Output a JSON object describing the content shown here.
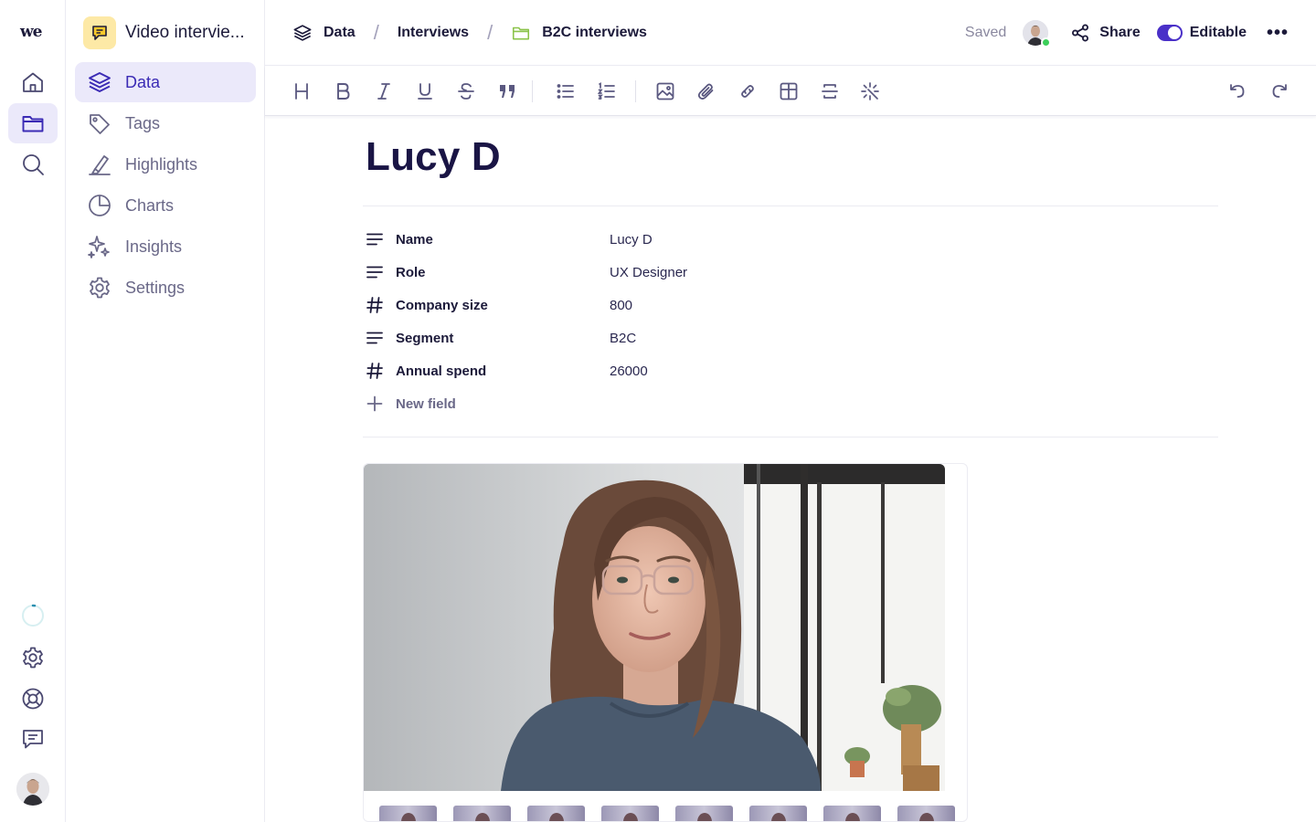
{
  "app": {
    "logo": "we",
    "project_name": "Video intervie..."
  },
  "rail": {
    "items": [
      {
        "icon": "home-icon"
      },
      {
        "icon": "folder-icon",
        "active": true
      },
      {
        "icon": "search-icon"
      }
    ],
    "bottom": [
      {
        "icon": "spinner-icon"
      },
      {
        "icon": "gear-icon"
      },
      {
        "icon": "help-lifebuoy-icon"
      },
      {
        "icon": "chat-icon"
      },
      {
        "icon": "avatar"
      }
    ]
  },
  "sidebar": {
    "items": [
      {
        "label": "Data",
        "icon": "layers-icon",
        "active": true
      },
      {
        "label": "Tags",
        "icon": "tag-icon"
      },
      {
        "label": "Highlights",
        "icon": "highlighter-icon"
      },
      {
        "label": "Charts",
        "icon": "pie-chart-icon"
      },
      {
        "label": "Insights",
        "icon": "sparkles-icon"
      },
      {
        "label": "Settings",
        "icon": "gear-icon"
      }
    ]
  },
  "breadcrumb": {
    "items": [
      {
        "label": "Data",
        "icon": "layers-icon"
      },
      {
        "label": "Interviews"
      },
      {
        "label": "B2C interviews",
        "icon": "folder-icon"
      }
    ],
    "separator": "/"
  },
  "header": {
    "saved": "Saved",
    "share": "Share",
    "editable": "Editable",
    "more": "•••"
  },
  "toolbar": {
    "buttons": [
      "heading",
      "bold",
      "italic",
      "underline",
      "strikethrough",
      "quote",
      "bullet-list",
      "numbered-list",
      "image",
      "attachment",
      "link",
      "table",
      "divider",
      "magic"
    ],
    "undo": "undo",
    "redo": "redo"
  },
  "document": {
    "title": "Lucy D",
    "fields": [
      {
        "icon": "text-icon",
        "name": "Name",
        "value": "Lucy D"
      },
      {
        "icon": "text-icon",
        "name": "Role",
        "value": "UX Designer"
      },
      {
        "icon": "hash-icon",
        "name": "Company size",
        "value": "800"
      },
      {
        "icon": "text-icon",
        "name": "Segment",
        "value": "B2C"
      },
      {
        "icon": "hash-icon",
        "name": "Annual spend",
        "value": "26000"
      }
    ],
    "new_field": "New field"
  },
  "video": {
    "thumbnail_count": 8
  },
  "colors": {
    "accent": "#3b2bb5",
    "active_bg": "#ebe9fa",
    "text": "#1c1a3a",
    "muted": "#6a6888",
    "online": "#3ccf5a",
    "project_icon_bg": "#fde9a6"
  }
}
